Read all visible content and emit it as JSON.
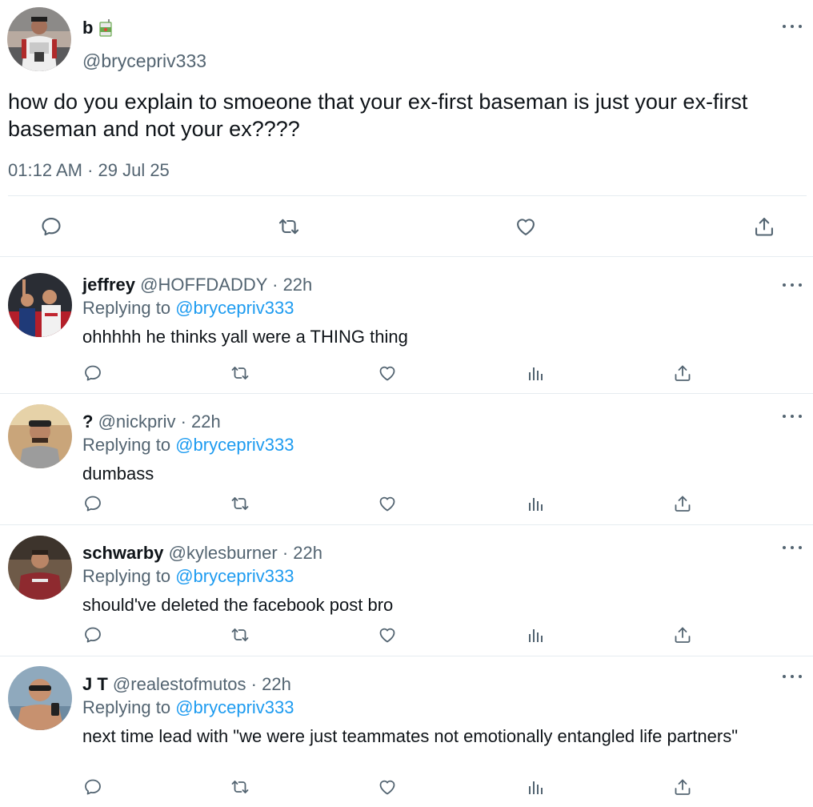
{
  "main_tweet": {
    "name": "b",
    "name_emoji": "juice-box-icon",
    "handle": "@brycepriv333",
    "text": "how do you explain to smoeone that your ex-first baseman is just your ex-first baseman and not your ex????",
    "timestamp": "01:12 AM · 29 Jul 25",
    "actions": [
      "reply-icon",
      "retweet-icon",
      "like-icon",
      "share-icon"
    ]
  },
  "replies": [
    {
      "name": "jeffrey",
      "handle": "@HOFFDADDY",
      "time": "· 22h",
      "replying_prefix": "Replying to",
      "replying_to": "@brycepriv333",
      "text": "ohhhhh he thinks yall were a THING thing"
    },
    {
      "name": "?",
      "handle": "@nickpriv",
      "time": "· 22h",
      "replying_prefix": "Replying to",
      "replying_to": "@brycepriv333",
      "text": "dumbass"
    },
    {
      "name": "schwarby",
      "handle": "@kylesburner",
      "time": "· 22h",
      "replying_prefix": "Replying to",
      "replying_to": "@brycepriv333",
      "text": "should've deleted the facebook post bro"
    },
    {
      "name": "J T",
      "handle": "@realestofmutos",
      "time": "· 22h",
      "replying_prefix": "Replying to",
      "replying_to": "@brycepriv333",
      "text": "next time lead with \"we were just teammates not emotionally entangled life partners\""
    }
  ],
  "reply_actions": [
    "reply-icon",
    "retweet-icon",
    "like-icon",
    "views-icon",
    "share-icon"
  ],
  "colors": {
    "text": "#0f1419",
    "secondary": "#536471",
    "link": "#1d9bf0",
    "divider": "#e6ecf0"
  }
}
